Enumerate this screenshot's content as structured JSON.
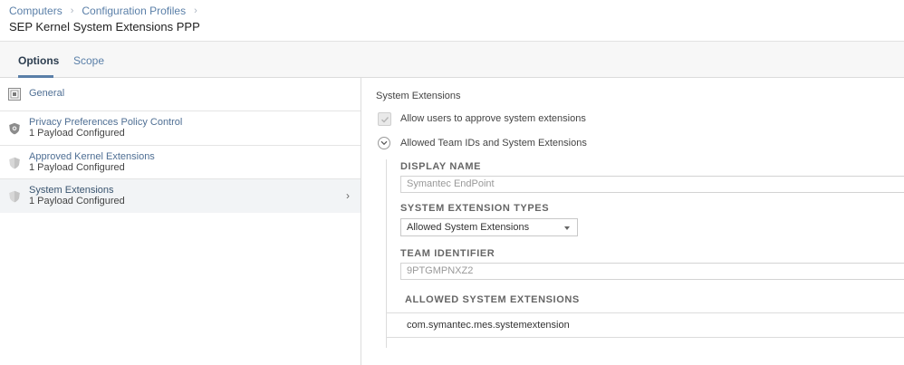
{
  "breadcrumb": {
    "items": [
      "Computers",
      "Configuration Profiles"
    ]
  },
  "page_title": "SEP Kernel System Extensions PPP",
  "tabs": [
    {
      "label": "Options",
      "active": true
    },
    {
      "label": "Scope",
      "active": false
    }
  ],
  "sidebar": {
    "items": [
      {
        "label": "General",
        "sub": "",
        "icon": "general-icon",
        "selected": false
      },
      {
        "label": "Privacy Preferences Policy Control",
        "sub": "1 Payload Configured",
        "icon": "shield-icon",
        "selected": false
      },
      {
        "label": "Approved Kernel Extensions",
        "sub": "1 Payload Configured",
        "icon": "shield-icon",
        "selected": false
      },
      {
        "label": "System Extensions",
        "sub": "1 Payload Configured",
        "icon": "shield-icon",
        "selected": true
      }
    ]
  },
  "main": {
    "section_title": "System Extensions",
    "allow_users_label": "Allow users to approve system extensions",
    "allow_users_checked": true,
    "allowed_group_label": "Allowed Team IDs and System Extensions",
    "display_name": {
      "label": "DISPLAY NAME",
      "value": "Symantec EndPoint"
    },
    "extension_types": {
      "label": "SYSTEM EXTENSION TYPES",
      "selected": "Allowed System Extensions"
    },
    "team_identifier": {
      "label": "TEAM IDENTIFIER",
      "value": "9PTGMPNXZ2"
    },
    "allowed_extensions": {
      "header": "ALLOWED SYSTEM EXTENSIONS",
      "rows": [
        "com.symantec.mes.systemextension"
      ]
    }
  },
  "colors": {
    "link": "#5a7fa8",
    "accent": "#5a7fa8",
    "selected_bg": "#f2f4f6"
  }
}
